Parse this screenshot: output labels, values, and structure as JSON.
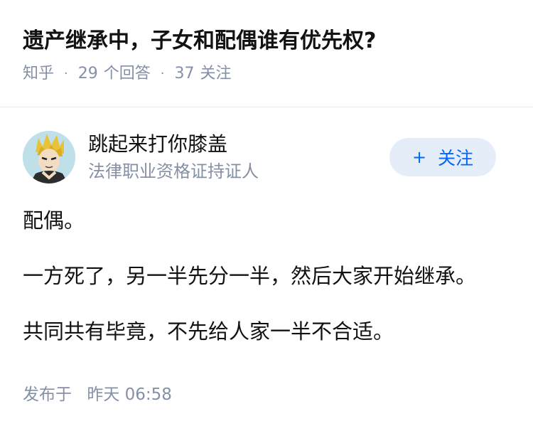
{
  "question": {
    "title": "遗产继承中，子女和配偶谁有优先权?",
    "source": "知乎",
    "answer_count": "29",
    "answer_label": "个回答",
    "follower_count": "37",
    "follower_label": "关注"
  },
  "author": {
    "name": "跳起来打你膝盖",
    "badge": "法律职业资格证持证人",
    "follow_plus": "+",
    "follow_label": "关注"
  },
  "answer": {
    "paragraphs": [
      "配偶。",
      "一方死了，另一半先分一半，然后大家开始继承。",
      "共同共有毕竟，不先给人家一半不合适。"
    ]
  },
  "published": {
    "label": "发布于",
    "time": "昨天 06:58"
  },
  "colors": {
    "title": "#121212",
    "meta": "#8590a6",
    "follow_bg": "#e5eef8",
    "follow_text": "#0066ff"
  }
}
